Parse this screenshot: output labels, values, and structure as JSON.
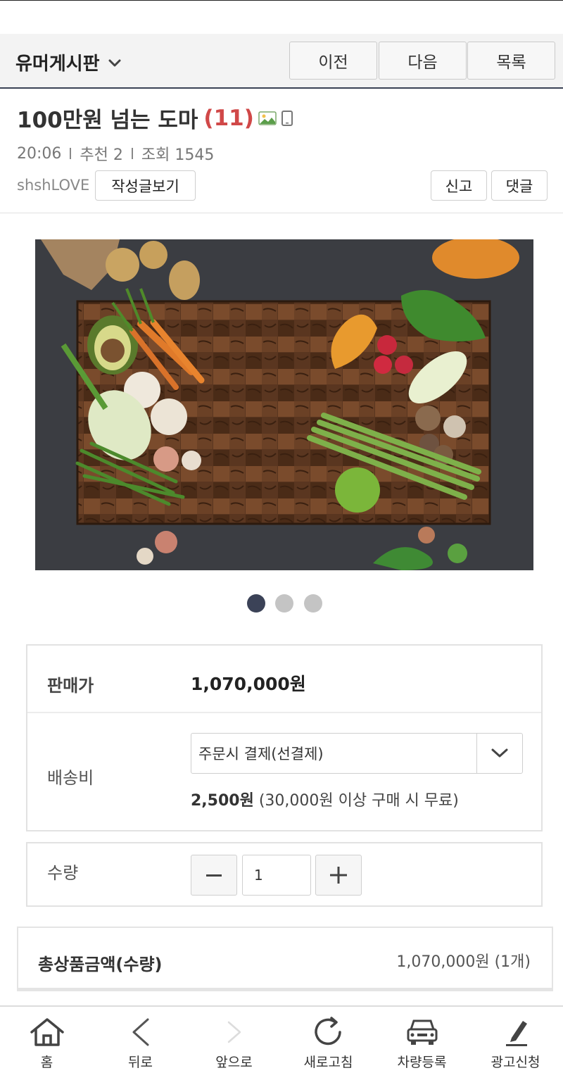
{
  "header": {
    "board_name": "유머게시판",
    "prev_label": "이전",
    "next_label": "다음",
    "list_label": "목록"
  },
  "post": {
    "title": "100만원 넘는 도마",
    "comment_count": "(11)",
    "time": "20:06",
    "recommend": "추천 2",
    "views": "조회 1545",
    "author": "shshLOVE",
    "view_posts_label": "작성글보기",
    "report_label": "신고",
    "comment_label": "댓글"
  },
  "carousel": {
    "active_index": 0,
    "dot_count": 3,
    "active_color": "#3b4257",
    "inactive_color": "#c4c4c4"
  },
  "product": {
    "price_label": "판매가",
    "price_value": "1,070,000원",
    "shipping_label": "배송비",
    "shipping_option": "주문시 결제(선결제)",
    "shipping_fee": "2,500원",
    "shipping_note": "(30,000원 이상 구매 시 무료)",
    "quantity_label": "수량",
    "quantity_value": "1",
    "total_label": "총상품금액(수량)",
    "total_value": "1,070,000원 (1개)"
  },
  "bottom_nav": [
    {
      "label": "홈",
      "icon": "home-icon"
    },
    {
      "label": "뒤로",
      "icon": "back-icon"
    },
    {
      "label": "앞으로",
      "icon": "forward-icon"
    },
    {
      "label": "새로고침",
      "icon": "refresh-icon"
    },
    {
      "label": "차량등록",
      "icon": "car-icon"
    },
    {
      "label": "광고신청",
      "icon": "pen-icon"
    }
  ],
  "colors": {
    "accent_count": "#d04848",
    "header_border": "#3a4255"
  }
}
